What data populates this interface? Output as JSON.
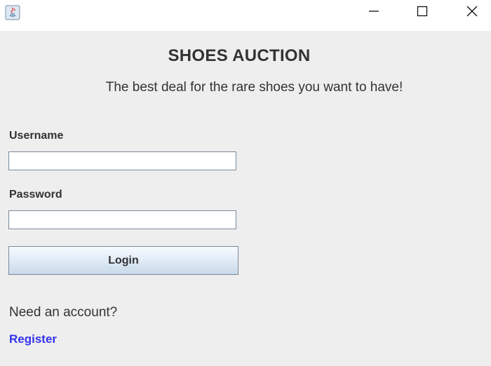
{
  "window": {
    "controls": {
      "minimize_icon": "minimize-icon",
      "maximize_icon": "maximize-icon",
      "close_icon": "close-icon"
    },
    "app_icon": "java-icon"
  },
  "header": {
    "title": "SHOES AUCTION",
    "subtitle": "The best deal for the rare shoes you want to have!"
  },
  "form": {
    "username_label": "Username",
    "username_value": "",
    "password_label": "Password",
    "password_value": "",
    "login_label": "Login"
  },
  "footer": {
    "need_account_text": "Need an account?",
    "register_label": "Register"
  },
  "colors": {
    "background": "#eeeeee",
    "titlebar": "#ffffff",
    "text": "#333333",
    "link": "#3333ee",
    "field_border": "#7a8a99"
  }
}
